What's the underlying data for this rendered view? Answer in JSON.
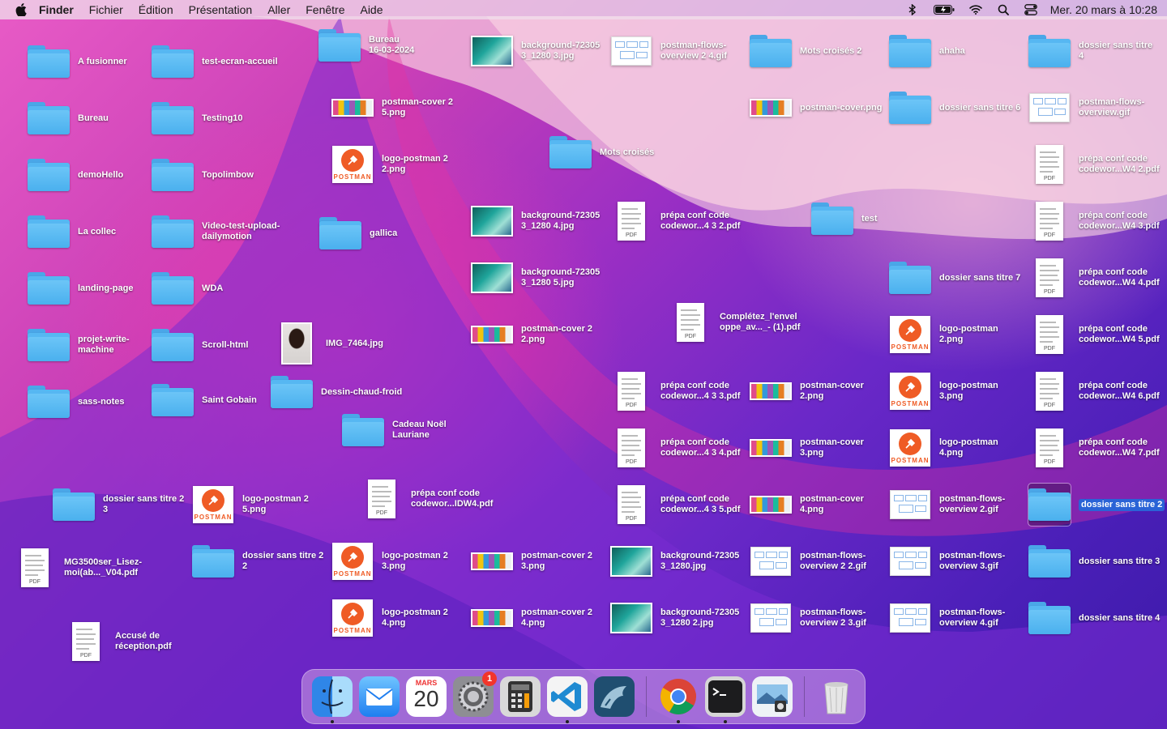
{
  "menubar": {
    "apple_icon": "apple-icon",
    "app_name": "Finder",
    "menus": [
      "Fichier",
      "Édition",
      "Présentation",
      "Aller",
      "Fenêtre",
      "Aide"
    ],
    "status_icons": [
      "bluetooth-icon",
      "battery-icon",
      "wifi-icon",
      "spotlight-search-icon",
      "control-center-icon"
    ],
    "clock": "Mer. 20 mars à  10:28"
  },
  "desktop": {
    "items": [
      {
        "label": "A fusionner",
        "type": "folder"
      },
      {
        "label": "Bureau",
        "type": "folder"
      },
      {
        "label": "demoHello",
        "type": "folder"
      },
      {
        "label": "La collec",
        "type": "folder"
      },
      {
        "label": "landing-page",
        "type": "folder"
      },
      {
        "label": "projet-write-\nmachine",
        "type": "folder"
      },
      {
        "label": "sass-notes",
        "type": "folder"
      },
      {
        "label": "test-ecran-accueil",
        "type": "folder"
      },
      {
        "label": "Testing10",
        "type": "folder"
      },
      {
        "label": "Topolimbow",
        "type": "folder"
      },
      {
        "label": "Video-test-upload-\ndailymotion",
        "type": "folder"
      },
      {
        "label": "WDA",
        "type": "folder"
      },
      {
        "label": "Scroll-html",
        "type": "folder"
      },
      {
        "label": "Saint Gobain",
        "type": "folder"
      },
      {
        "label": "Bureau\n16-03-2024",
        "type": "folder"
      },
      {
        "label": "postman-cover 2\n5.png",
        "type": "cover"
      },
      {
        "label": "logo-postman 2\n2.png",
        "type": "logo"
      },
      {
        "label": "gallica",
        "type": "folder"
      },
      {
        "label": "IMG_7464.jpg",
        "type": "photo"
      },
      {
        "label": "Dessin-chaud-froid",
        "type": "folder"
      },
      {
        "label": "Cadeau Noël\nLauriane",
        "type": "folder"
      },
      {
        "label": "background-72305\n3_1280 3.jpg",
        "type": "bg"
      },
      {
        "label": "background-72305\n3_1280 4.jpg",
        "type": "bg"
      },
      {
        "label": "background-72305\n3_1280 5.jpg",
        "type": "bg"
      },
      {
        "label": "postman-cover 2\n2.png",
        "type": "cover"
      },
      {
        "label": "Mots croisés",
        "type": "folder"
      },
      {
        "label": "postman-flows-\noverview 2 4.gif",
        "type": "gif"
      },
      {
        "label": "prépa conf code\ncodewor...4 3 2.pdf",
        "type": "pdf"
      },
      {
        "label": "Complétez_l'envel\noppe_av..._- (1).pdf",
        "type": "pdf"
      },
      {
        "label": "prépa conf code\ncodewor...4 3 3.pdf",
        "type": "pdf"
      },
      {
        "label": "prépa conf code\ncodewor...4 3 4.pdf",
        "type": "pdf"
      },
      {
        "label": "prépa conf code\ncodewor...4 3 5.pdf",
        "type": "pdf"
      },
      {
        "label": "Mots croisés 2",
        "type": "folder"
      },
      {
        "label": "postman-cover.png",
        "type": "cover"
      },
      {
        "label": "test",
        "type": "folder"
      },
      {
        "label": "postman-cover\n2.png",
        "type": "cover"
      },
      {
        "label": "postman-cover\n3.png",
        "type": "cover"
      },
      {
        "label": "postman-cover\n4.png",
        "type": "cover"
      },
      {
        "label": "ahaha",
        "type": "folder"
      },
      {
        "label": "dossier sans titre 6",
        "type": "folder"
      },
      {
        "label": "dossier sans titre 7",
        "type": "folder"
      },
      {
        "label": "logo-postman\n2.png",
        "type": "logo"
      },
      {
        "label": "logo-postman\n3.png",
        "type": "logo"
      },
      {
        "label": "logo-postman\n4.png",
        "type": "logo"
      },
      {
        "label": "postman-flows-\noverview 2.gif",
        "type": "gif"
      },
      {
        "label": "dossier sans titre\n4",
        "type": "folder"
      },
      {
        "label": "postman-flows-\noverview.gif",
        "type": "gif"
      },
      {
        "label": "prépa conf code\ncodewor...W4 2.pdf",
        "type": "pdf"
      },
      {
        "label": "prépa conf code\ncodewor...W4 3.pdf",
        "type": "pdf"
      },
      {
        "label": "prépa conf code\ncodewor...W4 4.pdf",
        "type": "pdf"
      },
      {
        "label": "prépa conf code\ncodewor...W4 5.pdf",
        "type": "pdf"
      },
      {
        "label": "prépa conf code\ncodewor...W4 6.pdf",
        "type": "pdf"
      },
      {
        "label": "prépa conf code\ncodewor...W4 7.pdf",
        "type": "pdf"
      },
      {
        "label": "dossier sans titre 2",
        "type": "folder",
        "selected": true
      },
      {
        "label": "dossier sans titre 3",
        "type": "folder"
      },
      {
        "label": "dossier sans titre 4",
        "type": "folder"
      },
      {
        "label": "dossier sans titre 2\n3",
        "type": "folder"
      },
      {
        "label": "logo-postman 2\n5.png",
        "type": "logo"
      },
      {
        "label": "prépa conf code\ncodewor...IDW4.pdf",
        "type": "pdf"
      },
      {
        "label": "MG3500ser_Lisez-\nmoi(ab..._V04.pdf",
        "type": "pdf"
      },
      {
        "label": "dossier sans titre 2\n2",
        "type": "folder"
      },
      {
        "label": "logo-postman 2\n3.png",
        "type": "logo"
      },
      {
        "label": "logo-postman 2\n4.png",
        "type": "logo"
      },
      {
        "label": "postman-cover 2\n3.png",
        "type": "cover"
      },
      {
        "label": "postman-cover 2\n4.png",
        "type": "cover"
      },
      {
        "label": "background-72305\n3_1280.jpg",
        "type": "bg"
      },
      {
        "label": "background-72305\n3_1280 2.jpg",
        "type": "bg"
      },
      {
        "label": "postman-flows-\noverview 2 2.gif",
        "type": "gif"
      },
      {
        "label": "postman-flows-\noverview 2 3.gif",
        "type": "gif"
      },
      {
        "label": "postman-flows-\noverview 3.gif",
        "type": "gif"
      },
      {
        "label": "postman-flows-\noverview 4.gif",
        "type": "gif"
      },
      {
        "label": "Accusé de\nréception.pdf",
        "type": "pdf"
      }
    ]
  },
  "dock": {
    "apps": [
      {
        "name": "finder-icon",
        "running": true
      },
      {
        "name": "mail-icon",
        "running": false
      },
      {
        "name": "calendar-icon",
        "running": false,
        "month": "MARS",
        "day": "20"
      },
      {
        "name": "system-settings-icon",
        "running": false,
        "badge": "1"
      },
      {
        "name": "calculator-icon",
        "running": false
      },
      {
        "name": "vscode-icon",
        "running": true
      },
      {
        "name": "mysql-workbench-icon",
        "running": false
      },
      {
        "name": "chrome-icon",
        "running": true
      },
      {
        "name": "terminal-icon",
        "running": true
      },
      {
        "name": "preview-icon",
        "running": false
      },
      {
        "name": "trash-icon",
        "running": false
      }
    ]
  }
}
